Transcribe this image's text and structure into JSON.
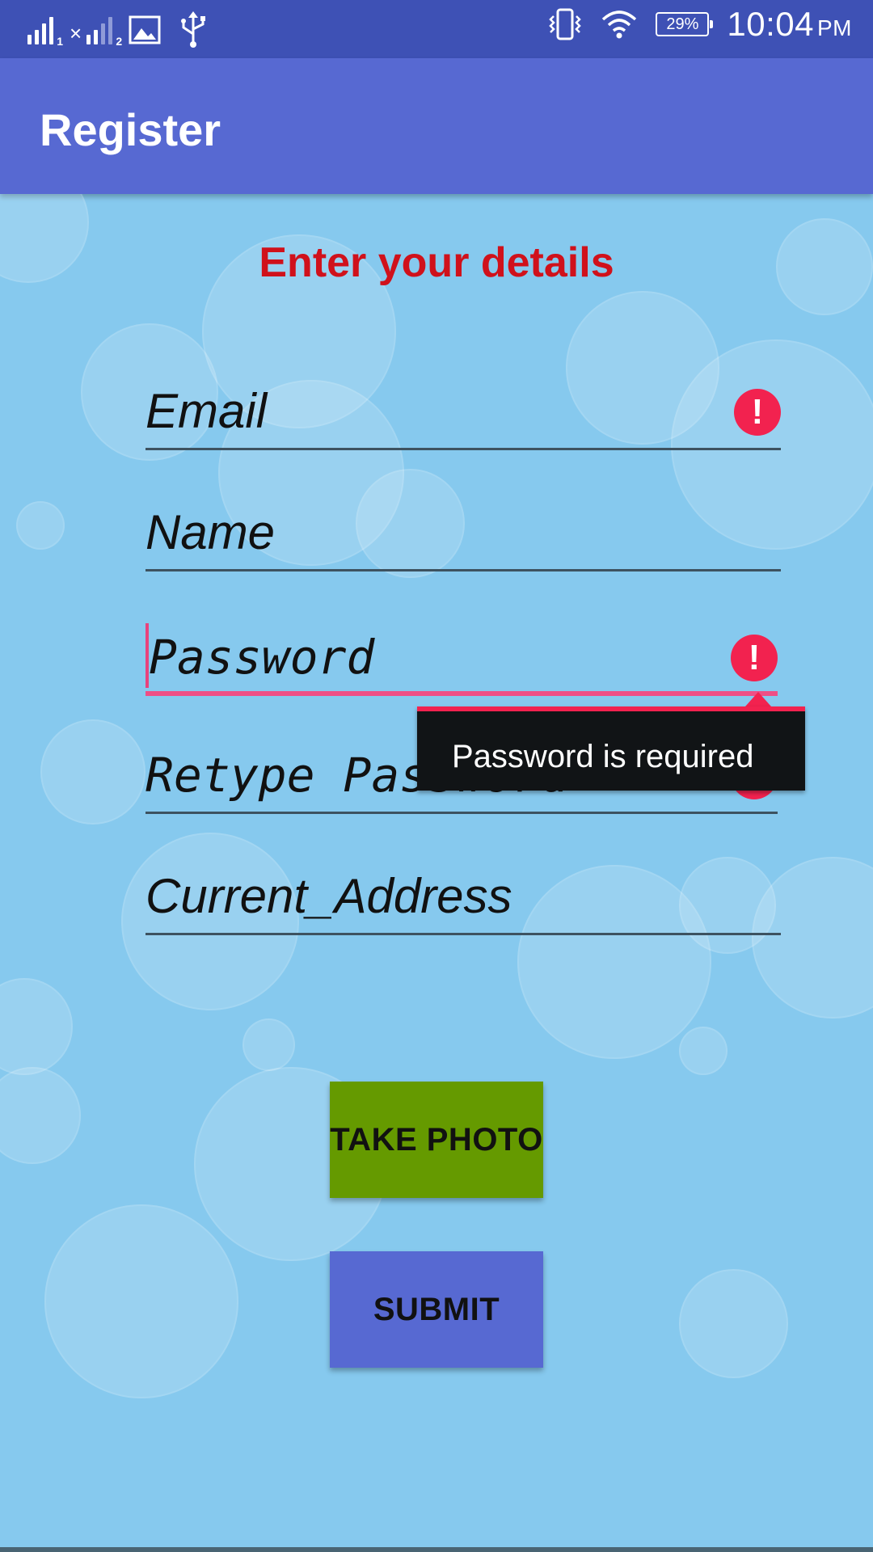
{
  "status_bar": {
    "sim1_label": "1",
    "sim2_label": "2",
    "battery": "29%",
    "time": "10:04",
    "ampm": "PM",
    "icons": [
      "signal-icon",
      "signal-icon",
      "image-icon",
      "usb-icon",
      "vibrate-icon",
      "wifi-icon",
      "battery-icon"
    ]
  },
  "app_bar": {
    "title": "Register"
  },
  "form": {
    "heading": "Enter your details",
    "email": "Email",
    "name": "Name",
    "password": "Password",
    "retype_password": "Retype Password",
    "current_address": "Current_Address",
    "error_tooltip": "Password is required",
    "error_glyph": "!"
  },
  "buttons": {
    "take_photo": "TAKE PHOTO",
    "submit": "SUBMIT"
  },
  "colors": {
    "status_bar": "#3e51b5",
    "app_bar": "#5769d2",
    "heading": "#d0111b",
    "error": "#f2224f",
    "take_photo": "#659a00",
    "submit": "#5769d2"
  }
}
